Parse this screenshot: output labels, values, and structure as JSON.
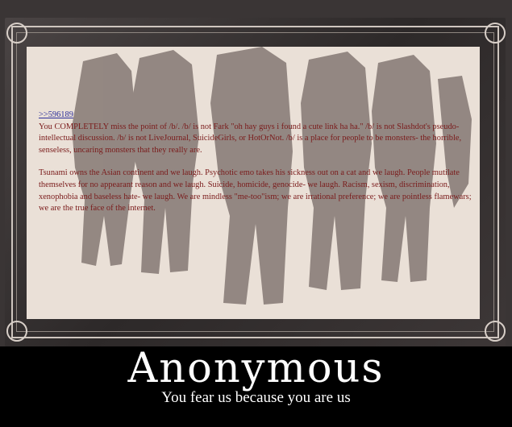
{
  "post": {
    "quote_link": ">>596189",
    "paragraph1": "You COMPLETELY miss the point of /b/. /b/ is not Fark \"oh hay guys i found a cute link ha ha.\" /b/ is not Slashdot's pseudo-intellectual discussion. /b/ is not LiveJournal, SuicideGirls, or HotOrNot. /b/ is a place for people to be monsters- the horrible, senseless, uncaring monsters that they really are.",
    "paragraph2": "Tsunami owns the Asian continent and we laugh. Psychotic emo takes his sickness out on a cat and we laugh. People mutilate themselves for no appearant reason and we laugh. Suicide, homicide, genocide- we laugh. Racism, sexism, discrimination, xenophobia and baseless hate- we laugh. We are mindless \"me-too\"ism; we are irrational preference; we are pointless flamewars; we are the true face of the internet."
  },
  "caption": {
    "title": "Anonymous",
    "subtitle": "You fear us because you are us"
  },
  "colors": {
    "background": "#000000",
    "canvas": "#eae0d7",
    "silhouette": "#8c807b",
    "post_text": "#7a1b1b",
    "link": "#2b2d9a"
  }
}
